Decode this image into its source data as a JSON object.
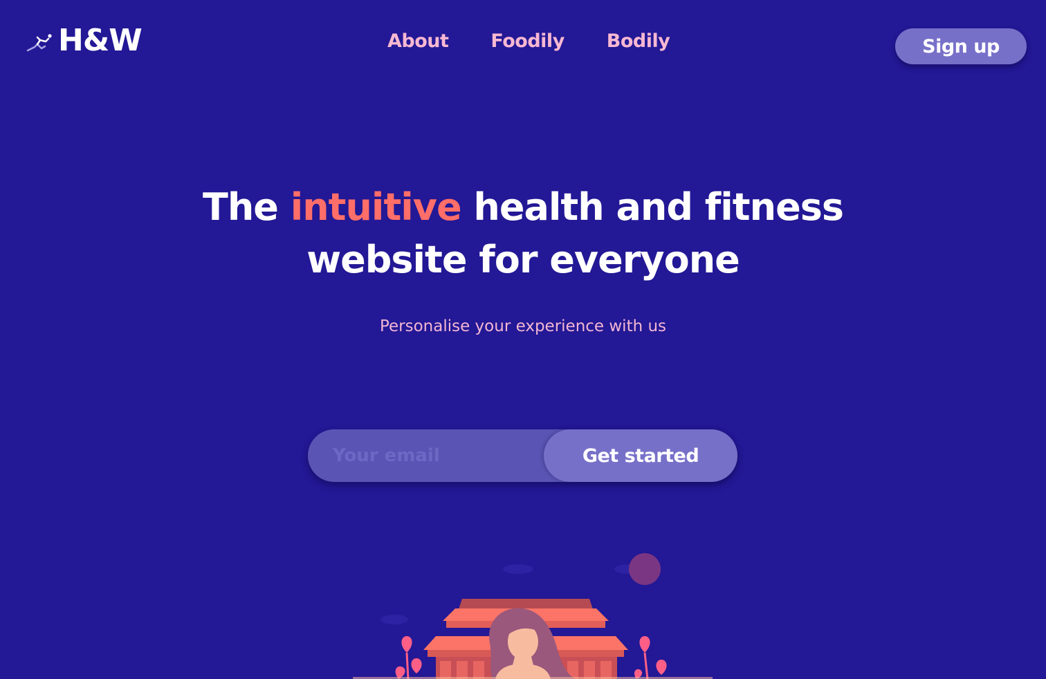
{
  "header": {
    "logo_text": "H&W",
    "logo_icon": "runner-icon",
    "nav": [
      {
        "label": "About"
      },
      {
        "label": "Foodily"
      },
      {
        "label": "Bodily"
      }
    ],
    "signup_label": "Sign up"
  },
  "hero": {
    "title_before": "The ",
    "title_accent": "intuitive",
    "title_after": " health and fitness website for everyone",
    "subtitle": "Personalise your experience with us"
  },
  "form": {
    "email_placeholder": "Your email",
    "email_value": "",
    "cta_label": "Get started"
  },
  "colors": {
    "background": "#231895",
    "accent": "#ff6e68",
    "nav_link": "#f7b8d2",
    "button": "#7770c9",
    "input_bg": "#5a55b4"
  }
}
